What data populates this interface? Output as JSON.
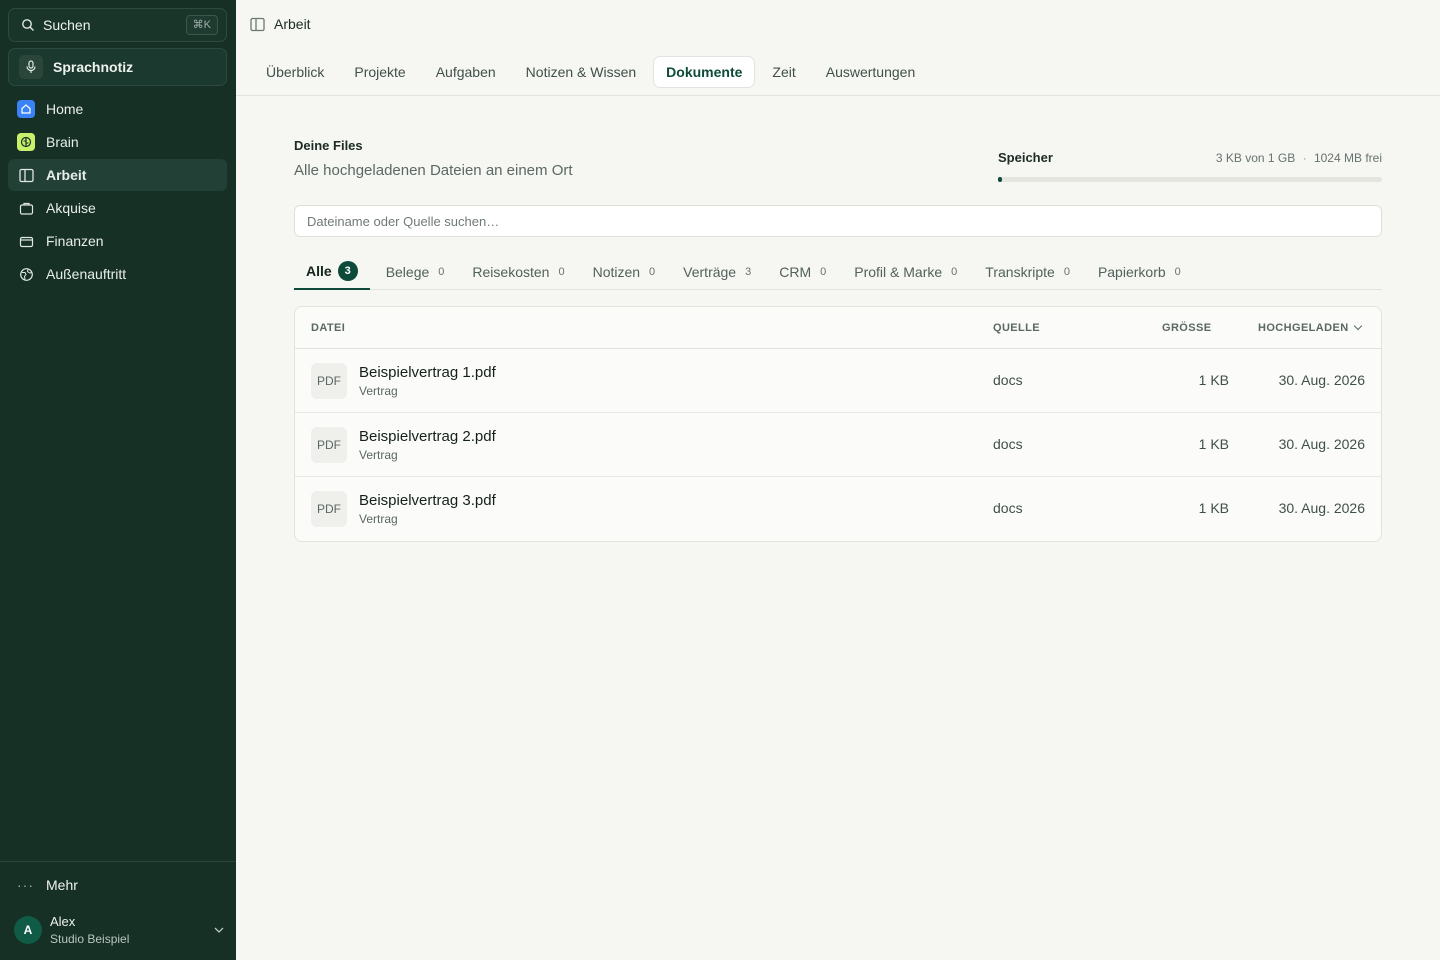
{
  "sidebar": {
    "search_label": "Suchen",
    "search_shortcut": "⌘K",
    "voice_label": "Sprachnotiz",
    "nav": [
      {
        "label": "Home",
        "icon": "home-icon"
      },
      {
        "label": "Brain",
        "icon": "brain-icon"
      },
      {
        "label": "Arbeit",
        "icon": "columns-icon",
        "active": true
      },
      {
        "label": "Akquise",
        "icon": "briefcase-icon"
      },
      {
        "label": "Finanzen",
        "icon": "wallet-icon"
      },
      {
        "label": "Außenauftritt",
        "icon": "globe-icon"
      }
    ],
    "more_label": "Mehr",
    "user": {
      "initial": "A",
      "name": "Alex",
      "org": "Studio Beispiel"
    }
  },
  "header": {
    "title": "Arbeit"
  },
  "tabs": [
    "Überblick",
    "Projekte",
    "Aufgaben",
    "Notizen & Wissen",
    "Dokumente",
    "Zeit",
    "Auswertungen"
  ],
  "active_tab": "Dokumente",
  "files": {
    "title": "Deine Files",
    "subtitle": "Alle hochgeladenen Dateien an einem Ort",
    "storage_label": "Speicher",
    "storage_used": "3 KB von 1 GB",
    "storage_sep": "·",
    "storage_free": "1024 MB frei",
    "storage_fill_fraction": 0.01,
    "search_placeholder": "Dateiname oder Quelle suchen…"
  },
  "category_tabs": [
    {
      "label": "Alle",
      "count": "3",
      "active": true
    },
    {
      "label": "Belege",
      "count": "0"
    },
    {
      "label": "Reisekosten",
      "count": "0"
    },
    {
      "label": "Notizen",
      "count": "0"
    },
    {
      "label": "Verträge",
      "count": "3"
    },
    {
      "label": "CRM",
      "count": "0"
    },
    {
      "label": "Profil & Marke",
      "count": "0"
    },
    {
      "label": "Transkripte",
      "count": "0"
    },
    {
      "label": "Papierkorb",
      "count": "0"
    }
  ],
  "table": {
    "columns": {
      "file": "DATEI",
      "source": "QUELLE",
      "size": "GRÖSSE",
      "uploaded": "HOCHGELADEN"
    },
    "rows": [
      {
        "badge": "PDF",
        "name": "Beispielvertrag 1.pdf",
        "type": "Vertrag",
        "source": "docs",
        "size": "1 KB",
        "date": "30. Aug. 2026"
      },
      {
        "badge": "PDF",
        "name": "Beispielvertrag 2.pdf",
        "type": "Vertrag",
        "source": "docs",
        "size": "1 KB",
        "date": "30. Aug. 2026"
      },
      {
        "badge": "PDF",
        "name": "Beispielvertrag 3.pdf",
        "type": "Vertrag",
        "source": "docs",
        "size": "1 KB",
        "date": "30. Aug. 2026"
      }
    ]
  },
  "colors": {
    "sidebar_bg": "#163026",
    "accent": "#0d4a3a",
    "home_icon": "#3b82f6",
    "brain_icon": "#c8f06a"
  }
}
